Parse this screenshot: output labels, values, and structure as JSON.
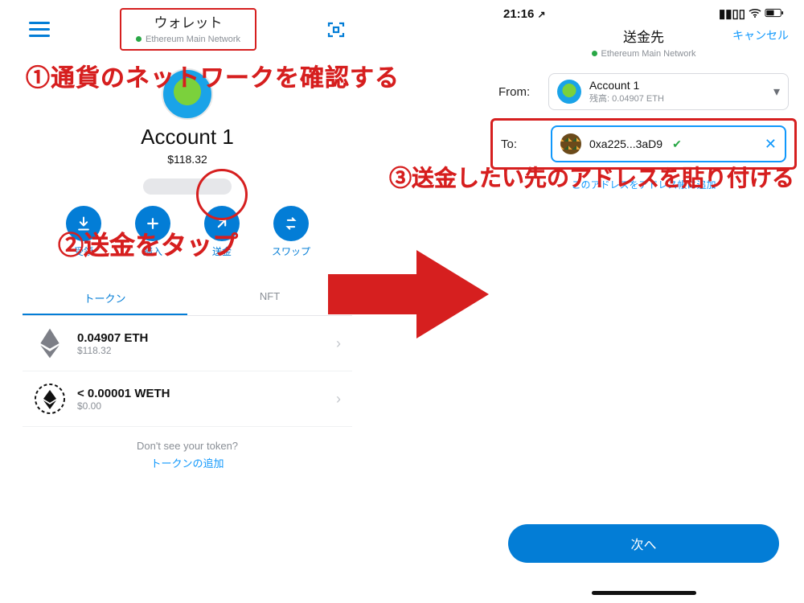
{
  "left": {
    "header_title": "ウォレット",
    "network": "Ethereum Main Network",
    "account_name": "Account 1",
    "fiat_balance": "$118.32",
    "actions": {
      "receive": "受領",
      "buy": "購入",
      "send": "送金",
      "swap": "スワップ"
    },
    "tabs": {
      "tokens": "トークン",
      "nft": "NFT"
    },
    "tokens": [
      {
        "amount": "0.04907 ETH",
        "fiat": "$118.32"
      },
      {
        "amount": "< 0.00001 WETH",
        "fiat": "$0.00"
      }
    ],
    "add_token": {
      "question": "Don't see your token?",
      "link": "トークンの追加"
    }
  },
  "right": {
    "status_time": "21:16",
    "title": "送金先",
    "network": "Ethereum Main Network",
    "cancel": "キャンセル",
    "from_label": "From:",
    "from_account": "Account 1",
    "from_balance": "残高: 0.04907 ETH",
    "to_label": "To:",
    "to_address": "0xa225...3aD9",
    "save_address_link": "このアドレスをアドレス帳に追加",
    "next": "次へ"
  },
  "annotations": {
    "a1": "①通貨のネットワークを確認する",
    "a2": "②送金をタップ",
    "a3": "③送金したい先のアドレスを貼り付ける"
  }
}
